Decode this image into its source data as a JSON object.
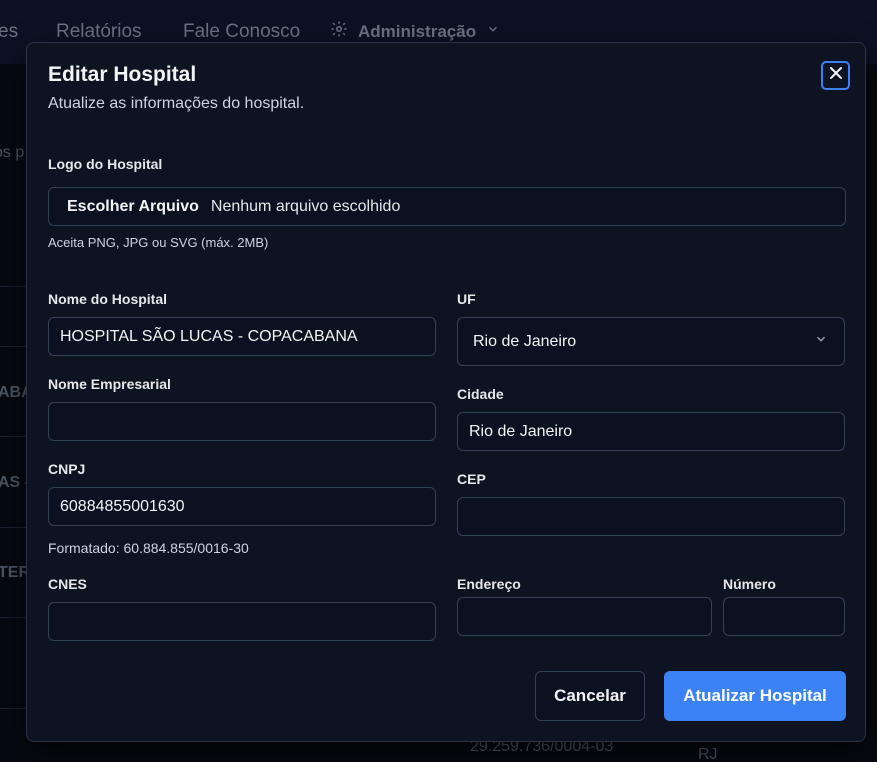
{
  "background": {
    "nav": {
      "partial_item": "es",
      "reports": "Relatórios",
      "contact": "Fale Conosco",
      "admin": "Administração"
    },
    "table_fragments": {
      "left_header": "os p",
      "row1": "ABA",
      "row2": "AS -",
      "row3": "TER",
      "bottom_cnpj": "29.259.736/0004-03",
      "bottom_uf": "RJ"
    }
  },
  "modal": {
    "title": "Editar Hospital",
    "subtitle": "Atualize as informações do hospital.",
    "logo": {
      "label": "Logo do Hospital",
      "button": "Escolher Arquivo",
      "status": "Nenhum arquivo escolhido",
      "hint": "Aceita PNG, JPG ou SVG (máx. 2MB)"
    },
    "hospital_name": {
      "label": "Nome do Hospital",
      "value": "HOSPITAL SÃO LUCAS - COPACABANA"
    },
    "company_name": {
      "label": "Nome Empresarial",
      "value": ""
    },
    "cnpj": {
      "label": "CNPJ",
      "value": "60884855001630",
      "formatted": "Formatado: 60.884.855/0016-30"
    },
    "cnes": {
      "label": "CNES",
      "value": ""
    },
    "uf": {
      "label": "UF",
      "selected": "Rio de Janeiro"
    },
    "city": {
      "label": "Cidade",
      "value": "Rio de Janeiro"
    },
    "cep": {
      "label": "CEP",
      "value": ""
    },
    "address": {
      "label": "Endereço",
      "value": ""
    },
    "number": {
      "label": "Número",
      "value": ""
    },
    "buttons": {
      "cancel": "Cancelar",
      "submit": "Atualizar Hospital"
    }
  },
  "colors": {
    "accent": "#3b82f6",
    "modal_bg": "#0d1320",
    "border": "#334155"
  },
  "icons": [
    "gear-icon",
    "chevron-down-icon",
    "close-icon"
  ]
}
